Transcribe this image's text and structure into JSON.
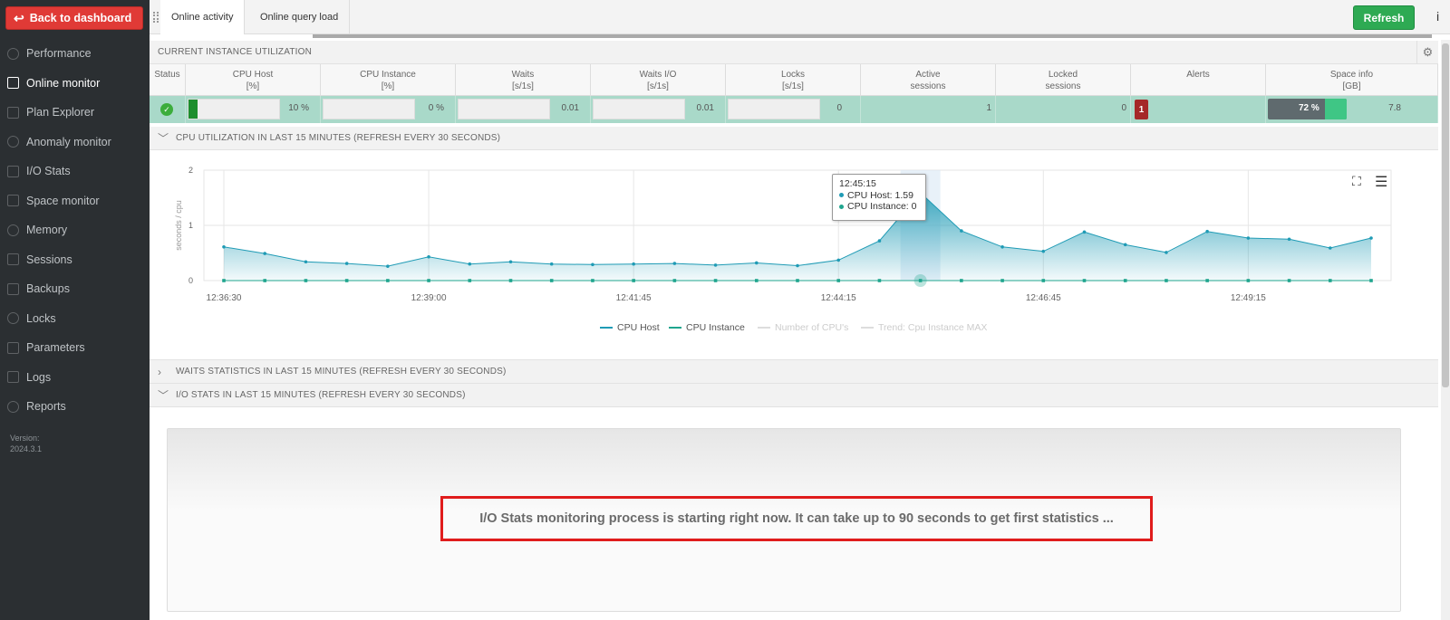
{
  "sidebar": {
    "back_label": "Back to dashboard",
    "items": [
      {
        "label": "Performance",
        "icon": "speedometer-icon",
        "active": false
      },
      {
        "label": "Online monitor",
        "icon": "window-icon",
        "active": true
      },
      {
        "label": "Plan Explorer",
        "icon": "eye-icon",
        "active": false
      },
      {
        "label": "Anomaly monitor",
        "icon": "book-icon",
        "active": false
      },
      {
        "label": "I/O Stats",
        "icon": "table-icon",
        "active": false
      },
      {
        "label": "Space monitor",
        "icon": "database-icon",
        "active": false
      },
      {
        "label": "Memory",
        "icon": "memory-icon",
        "active": false
      },
      {
        "label": "Sessions",
        "icon": "user-icon",
        "active": false
      },
      {
        "label": "Backups",
        "icon": "backup-icon",
        "active": false
      },
      {
        "label": "Locks",
        "icon": "lock-icon",
        "active": false
      },
      {
        "label": "Parameters",
        "icon": "grid-icon",
        "active": false
      },
      {
        "label": "Logs",
        "icon": "info-circle-icon",
        "active": false
      },
      {
        "label": "Reports",
        "icon": "book-open-icon",
        "active": false
      }
    ],
    "version_label": "Version:",
    "version_value": "2024.3.1"
  },
  "topbar": {
    "tabs": [
      {
        "label": "Online activity",
        "active": true
      },
      {
        "label": "Online query load",
        "active": false
      }
    ],
    "refresh_label": "Refresh",
    "info_label": "i"
  },
  "utilization": {
    "section_title": "CURRENT INSTANCE UTILIZATION",
    "headers": [
      {
        "line1": "Status",
        "line2": ""
      },
      {
        "line1": "CPU Host",
        "line2": "[%]"
      },
      {
        "line1": "CPU Instance",
        "line2": "[%]"
      },
      {
        "line1": "Waits",
        "line2": "[s/1s]"
      },
      {
        "line1": "Waits I/O",
        "line2": "[s/1s]"
      },
      {
        "line1": "Locks",
        "line2": "[s/1s]"
      },
      {
        "line1": "Active",
        "line2": "sessions"
      },
      {
        "line1": "Locked",
        "line2": "sessions"
      },
      {
        "line1": "Alerts",
        "line2": ""
      },
      {
        "line1": "Space info",
        "line2": "[GB]"
      }
    ],
    "values": {
      "cpu_host": "10 %",
      "cpu_host_fill": 0.1,
      "cpu_instance": "0 %",
      "waits": "0.01",
      "waits_io": "0.01",
      "locks": "0",
      "active_sessions": "1",
      "locked_sessions": "0",
      "alerts": "1",
      "space_pct": "72 %",
      "space_gb": "7.8"
    },
    "colors": {
      "row_bg": "#a9d9c9",
      "ok": "#3cad3c",
      "alert": "#a52828",
      "space_fill": "#3fc685"
    }
  },
  "cpu_section": {
    "title": "CPU UTILIZATION IN LAST 15 MINUTES (REFRESH EVERY 30 SECONDS)",
    "tooltip": {
      "time": "12:45:15",
      "host_line": "CPU Host: 1.59",
      "instance_line": "CPU Instance: 0"
    }
  },
  "chart_data": {
    "type": "area",
    "ylabel": "seconds / cpu",
    "ylim": [
      0,
      2
    ],
    "y_ticks": [
      "0",
      "1",
      "2"
    ],
    "x_tick_labels": [
      "12:36:30",
      "12:39:00",
      "12:41:45",
      "12:44:15",
      "12:46:45",
      "12:49:15"
    ],
    "x_tick_index": [
      0,
      5,
      10,
      15,
      20,
      25
    ],
    "x": [
      "12:36:30",
      "12:37:00",
      "12:37:30",
      "12:38:00",
      "12:38:30",
      "12:39:00",
      "12:39:30",
      "12:40:00",
      "12:40:30",
      "12:41:00",
      "12:41:30",
      "12:41:45",
      "12:42:15",
      "12:42:45",
      "12:43:15",
      "12:43:45",
      "12:44:15",
      "12:44:45",
      "12:45:15",
      "12:45:45",
      "12:46:15",
      "12:46:45",
      "12:47:15",
      "12:47:45",
      "12:48:15",
      "12:48:45",
      "12:49:15",
      "12:49:45",
      "12:50:15"
    ],
    "series": [
      {
        "name": "CPU Host",
        "color": "#1f9bb5",
        "values": [
          0.61,
          0.49,
          0.34,
          0.31,
          0.26,
          0.43,
          0.3,
          0.34,
          0.3,
          0.29,
          0.3,
          0.31,
          0.28,
          0.32,
          0.27,
          0.37,
          0.72,
          1.59,
          0.9,
          0.61,
          0.53,
          0.88,
          0.65,
          0.51,
          0.89,
          0.77,
          0.75,
          0.59,
          0.77
        ]
      },
      {
        "name": "CPU Instance",
        "color": "#1fa58e",
        "values": [
          0,
          0,
          0,
          0,
          0,
          0,
          0,
          0,
          0,
          0,
          0,
          0,
          0,
          0,
          0,
          0,
          0,
          0,
          0,
          0,
          0,
          0,
          0,
          0,
          0,
          0,
          0,
          0,
          0
        ]
      },
      {
        "name": "Number of CPU's",
        "hidden": true
      },
      {
        "name": "Trend: Cpu Instance MAX",
        "hidden": true
      }
    ],
    "highlight_index": 17,
    "grid": true,
    "legend": "bottom"
  },
  "waits_section": {
    "title": "WAITS STATISTICS IN LAST 15 MINUTES (REFRESH EVERY 30 SECONDS)"
  },
  "io_section": {
    "title": "I/O STATS IN LAST 15 MINUTES (REFRESH EVERY 30 SECONDS)",
    "message": "I/O Stats monitoring process is starting right now. It can take up to 90 seconds to get first statistics ..."
  }
}
